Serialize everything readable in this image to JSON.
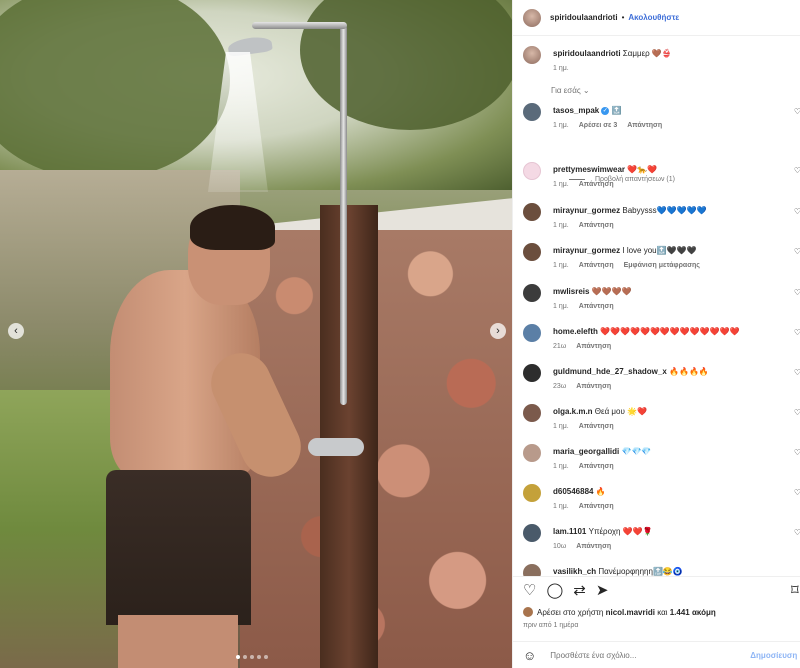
{
  "post": {
    "username": "spiridoulaandrioti",
    "separator": "•",
    "follow_label": "Ακολουθήστε",
    "caption": "Σαμμερ 🤎👙",
    "caption_time": "1 ημ.",
    "for_you_label": "Για εσάς",
    "image_dots": 5,
    "image_active_dot": 0
  },
  "comments": [
    {
      "user": "tasos_mpak",
      "verified": true,
      "text": "🔝",
      "time": "1 ημ.",
      "likes": "Αρέσει σε 3",
      "reply": "Απάντηση",
      "view_replies": "Προβολή απαντήσεων (1)",
      "avatar_color": "#5a6a7a"
    },
    {
      "user": "prettymeswimwear",
      "text": "❤️🐆❤️",
      "time": "1 ημ.",
      "reply": "Απάντηση",
      "avatar_color": "#f4d9e4"
    },
    {
      "user": "miraynur_gormez",
      "text": "Babyysss💙💙💙💙💙",
      "time": "1 ημ.",
      "reply": "Απάντηση",
      "avatar_color": "#6b4e3d"
    },
    {
      "user": "miraynur_gormez",
      "text": "I love you🔝🖤🖤🖤",
      "time": "1 ημ.",
      "reply": "Απάντηση",
      "translate": "Εμφάνιση μετάφρασης",
      "avatar_color": "#6b4e3d"
    },
    {
      "user": "mwlisreis",
      "text": "🤎🤎🤎🤎",
      "time": "1 ημ.",
      "reply": "Απάντηση",
      "avatar_color": "#3c3c3c"
    },
    {
      "user": "home.elefth",
      "text": "❤️❤️❤️❤️❤️❤️❤️❤️❤️❤️❤️❤️❤️❤️",
      "time": "21ω",
      "reply": "Απάντηση",
      "avatar_color": "#5b7fa6"
    },
    {
      "user": "guldmund_hde_27_shadow_x",
      "text": "🔥🔥🔥🔥",
      "time": "23ω",
      "reply": "Απάντηση",
      "avatar_color": "#2d2d2d"
    },
    {
      "user": "olga.k.m.n",
      "text": "Θεά μου 🌟❤️",
      "time": "1 ημ.",
      "reply": "Απάντηση",
      "avatar_color": "#7b5a4c"
    },
    {
      "user": "maria_georgallidi",
      "text": "💎💎💎",
      "time": "1 ημ.",
      "reply": "Απάντηση",
      "avatar_color": "#b89a8b"
    },
    {
      "user": "d60546884",
      "text": "🔥",
      "time": "1 ημ.",
      "reply": "Απάντηση",
      "avatar_color": "#c4a13a"
    },
    {
      "user": "lam.1101",
      "text": "Υπέροχη ❤️❤️🌹",
      "time": "10ω",
      "reply": "Απάντηση",
      "avatar_color": "#4a5a6a"
    },
    {
      "user": "vasilikh_ch",
      "text": "Πανέμορφηηηη🔝😂🧿",
      "time": "",
      "reply": "",
      "avatar_color": "#8a6f5e"
    }
  ],
  "footer": {
    "liked_by_prefix": "Αρέσει στο χρήστη",
    "liked_by_user": "nicol.mavridi",
    "liked_by_and": "και",
    "liked_by_count": "1.441 ακόμη",
    "post_date": "πριν από 1 ημέρα",
    "comment_placeholder": "Προσθέστε ένα σχόλιο...",
    "post_label": "Δημοσίευση"
  },
  "icons": {
    "like": "heart-icon",
    "comment": "comment-icon",
    "share": "share-icon",
    "send": "send-icon",
    "save": "save-icon",
    "emoji": "emoji-icon"
  },
  "colors": {
    "follow": "#3f6fd8",
    "post_button": "#8eb5f5",
    "muted": "#737373",
    "heart": "#ed4956"
  }
}
